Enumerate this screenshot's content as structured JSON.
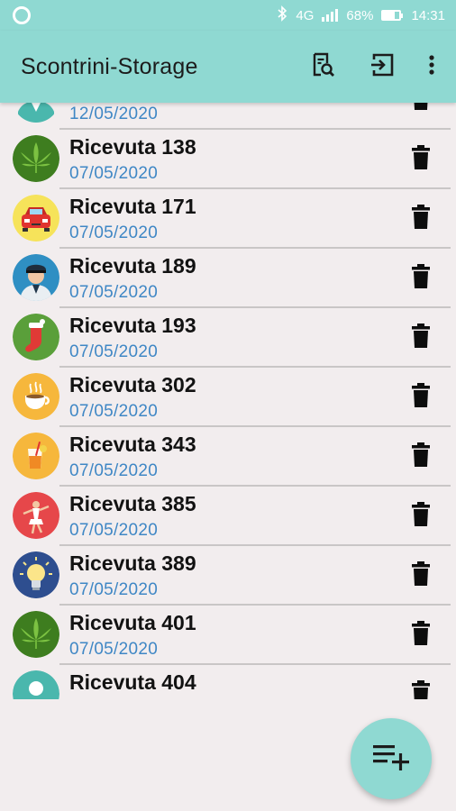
{
  "status_bar": {
    "network": "4G",
    "battery": "68%",
    "battery_level": 0.68,
    "time": "14:31",
    "icons": [
      "app-ring-icon",
      "bluetooth-icon",
      "signal-icon",
      "battery-charging-icon"
    ]
  },
  "app_bar": {
    "title": "Scontrini-Storage",
    "actions": [
      "search-receipt-icon",
      "exit-icon",
      "more-vert-icon"
    ]
  },
  "receipts": [
    {
      "title": "",
      "date": "12/05/2020",
      "avatar": "doctor"
    },
    {
      "title": "Ricevuta 138",
      "date": "07/05/2020",
      "avatar": "leaf"
    },
    {
      "title": "Ricevuta 171",
      "date": "07/05/2020",
      "avatar": "car"
    },
    {
      "title": "Ricevuta 189",
      "date": "07/05/2020",
      "avatar": "police"
    },
    {
      "title": "Ricevuta 193",
      "date": "07/05/2020",
      "avatar": "stocking"
    },
    {
      "title": "Ricevuta 302",
      "date": "07/05/2020",
      "avatar": "coffee"
    },
    {
      "title": "Ricevuta 343",
      "date": "07/05/2020",
      "avatar": "drink"
    },
    {
      "title": "Ricevuta 385",
      "date": "07/05/2020",
      "avatar": "dancer"
    },
    {
      "title": "Ricevuta 389",
      "date": "07/05/2020",
      "avatar": "bulb"
    },
    {
      "title": "Ricevuta 401",
      "date": "07/05/2020",
      "avatar": "leaf"
    },
    {
      "title": "Ricevuta 404",
      "date": "",
      "avatar": "partial"
    }
  ],
  "colors": {
    "primary": "#8fd9d2",
    "background": "#f2edee",
    "date_text": "#3f87c5"
  },
  "fab": {
    "icon": "playlist-add-icon"
  }
}
